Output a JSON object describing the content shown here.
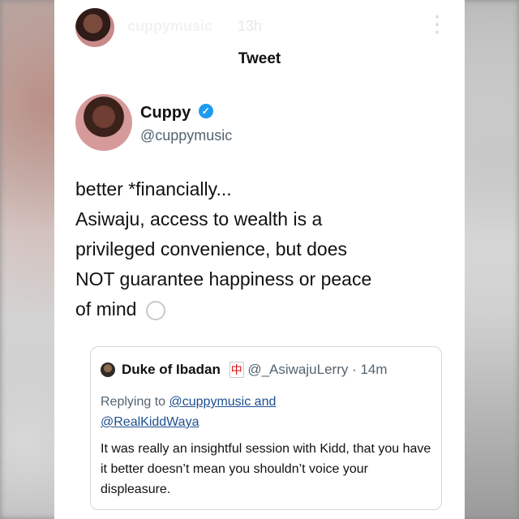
{
  "story": {
    "username": "cuppymusic",
    "time": "13h",
    "menu_icon": "kebab-menu-icon"
  },
  "tweet": {
    "header": "Tweet",
    "author_name": "Cuppy",
    "author_handle": "@cuppymusic",
    "verified_icon": "verified-icon",
    "text_lines": [
      "better *financially...",
      "Asiwaju, access to wealth is a",
      "privileged convenience, but does",
      "NOT guarantee happiness or peace",
      "of mind"
    ],
    "emoji_icon": "thought-bubble-icon"
  },
  "quoted_tweet": {
    "author_name": "Duke of Ibadan",
    "badge_icon": "mahjong-tile-icon",
    "author_handle": "@_AsiwajuLerry",
    "separator": " · ",
    "time": "14m",
    "replying_prefix": "Replying to",
    "reply_link_1": "@cuppymusic and",
    "reply_link_2": "@RealKiddWaya",
    "body": "It was really an insightful session with Kidd, that you have it better doesn’t mean you shouldn’t voice your displeasure."
  },
  "colors": {
    "verified": "#1d9bf0",
    "secondary_text": "#536471",
    "link": "#1d4f91"
  }
}
